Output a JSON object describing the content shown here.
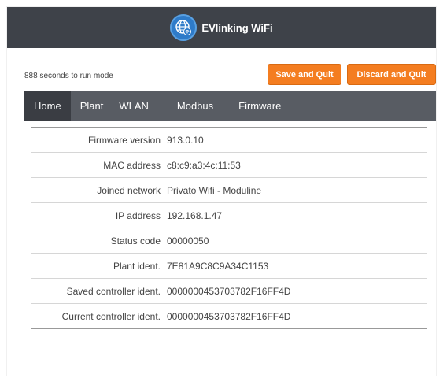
{
  "app": {
    "title": "EVlinking WiFi",
    "logo_icon": "wifi-globe-icon",
    "colors": {
      "header": "#3e4249",
      "accent": "#f47d20",
      "nav": "#585c63",
      "nav_active": "#3a3d43"
    }
  },
  "status": {
    "countdown_text": "888 seconds to run mode"
  },
  "toolbar": {
    "save_label": "Save and Quit",
    "discard_label": "Discard and Quit"
  },
  "nav": {
    "tabs": [
      {
        "label": "Home",
        "active": true
      },
      {
        "label": "Plant",
        "active": false
      },
      {
        "label": "WLAN",
        "active": false
      },
      {
        "label": "Modbus",
        "active": false
      },
      {
        "label": "Firmware",
        "active": false
      }
    ]
  },
  "info": {
    "rows": [
      {
        "label": "Firmware version",
        "value": "913.0.10"
      },
      {
        "label": "MAC address",
        "value": "c8:c9:a3:4c:11:53"
      },
      {
        "label": "Joined network",
        "value": "Privato Wifi - Moduline"
      },
      {
        "label": "IP address",
        "value": "192.168.1.47"
      },
      {
        "label": "Status code",
        "value": "00000050"
      },
      {
        "label": "Plant ident.",
        "value": "7E81A9C8C9A34C1153"
      },
      {
        "label": "Saved controller ident.",
        "value": "0000000453703782F16FF4D"
      },
      {
        "label": "Current controller ident.",
        "value": "0000000453703782F16FF4D"
      }
    ]
  }
}
